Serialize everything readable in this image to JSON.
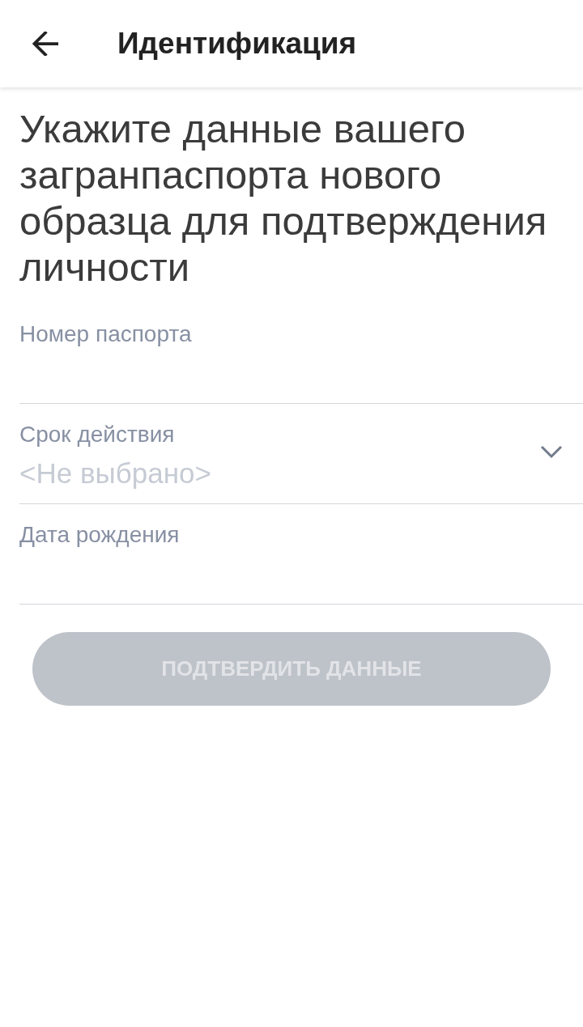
{
  "app_bar": {
    "title": "Идентификация"
  },
  "heading": "Укажите данные вашего загранпаспорта нового образца для подтверждения личности",
  "fields": [
    {
      "kind": "text",
      "label": "Номер паспорта"
    },
    {
      "kind": "select",
      "label": "Срок действия",
      "placeholder": "<Не выбрано>"
    },
    {
      "kind": "date",
      "label": "Дата рождения"
    }
  ],
  "submit": {
    "label": "ПОДТВЕРДИТЬ ДАННЫЕ",
    "disabled": true
  }
}
